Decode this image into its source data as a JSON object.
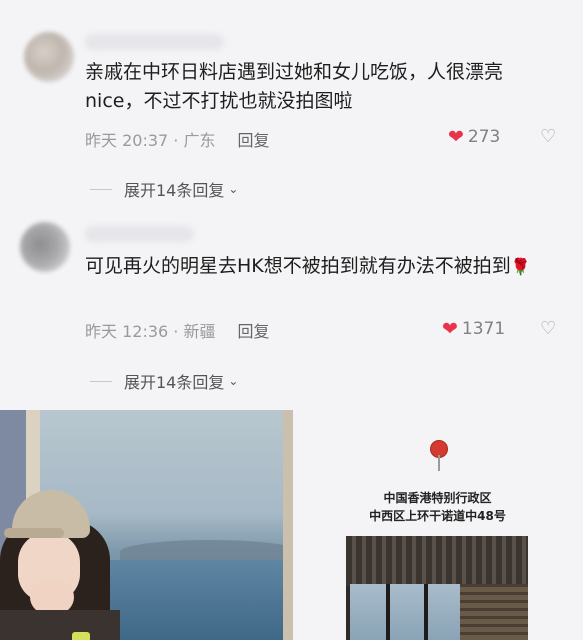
{
  "comments": [
    {
      "text": "亲戚在中环日料店遇到过她和女儿吃饭，人很漂亮nice，不过不打扰也就没拍图啦",
      "time": "昨天 20:37 · 广东",
      "reply": "回复",
      "likes": "273",
      "expand": "展开14条回复"
    },
    {
      "text": "可见再火的明星去HK想不被拍到就有办法不被拍到",
      "time": "昨天 12:36 · 新疆",
      "reply": "回复",
      "likes": "1371",
      "expand": "展开14条回复"
    }
  ],
  "map_card": {
    "line1": "中国香港特别行政区",
    "line2": "中西区上环干诺道中48号"
  },
  "icons": {
    "like": "heart-icon",
    "dislike": "broken-heart-icon",
    "expand": "chevron-down-icon",
    "pin": "location-pin-icon",
    "emoji": "rose-icon"
  },
  "colors": {
    "like_heart": "#e8334a",
    "background": "#f4f4f6"
  }
}
